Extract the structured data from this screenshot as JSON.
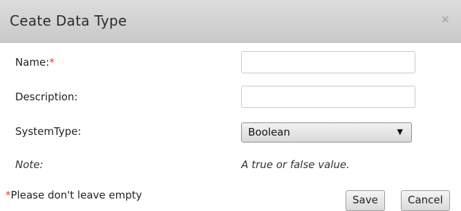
{
  "dialog": {
    "title": "Ceate Data Type",
    "close_icon": "×"
  },
  "form": {
    "name_label": "Name:",
    "name_required": "*",
    "name_value": "",
    "description_label": "Description:",
    "description_value": "",
    "system_type_label": "SystemType:",
    "system_type_value": "Boolean",
    "dropdown_icon": "▼",
    "note_label": "Note:",
    "note_value": "A true or false value."
  },
  "footer": {
    "required_marker": "*",
    "required_text": "Please don't leave empty",
    "save_label": "Save",
    "cancel_label": "Cancel"
  }
}
